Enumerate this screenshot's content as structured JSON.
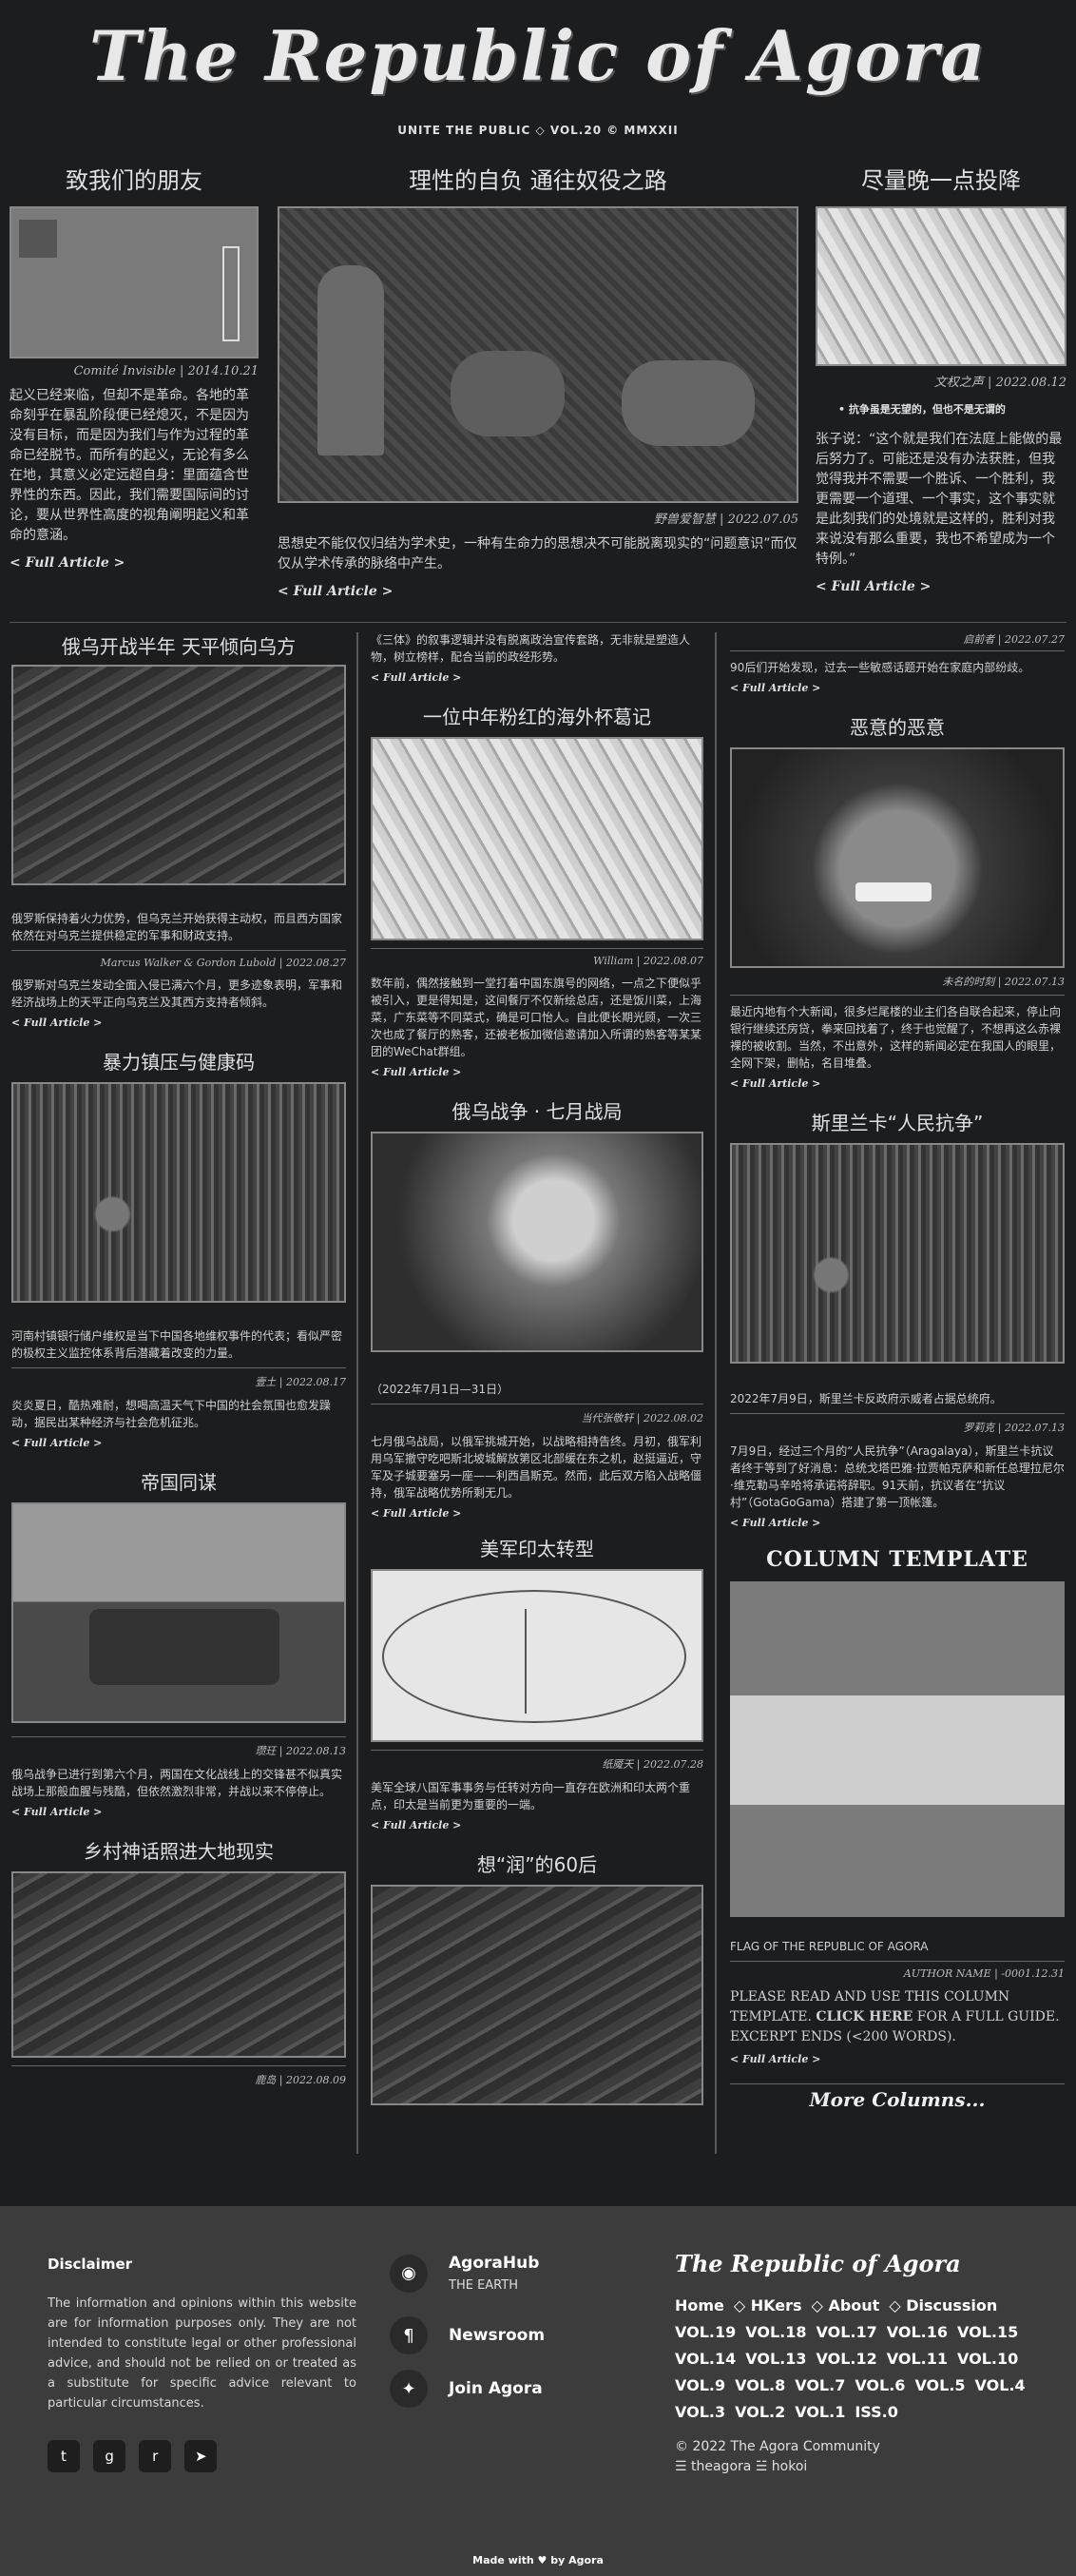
{
  "masthead": {
    "title": "The Republic of Agora",
    "subtitle": "UNITE THE PUBLIC ◇ VOL.20 © MMXXII"
  },
  "featured": [
    {
      "title": "致我们的朋友",
      "byline": "Comité Invisible | 2014.10.21",
      "body": "起义已经来临，但却不是革命。各地的革命刻乎在暴乱阶段便已经熄灭，不是因为没有目标，而是因为我们与作为过程的革命已经脱节。而所有的起义，无论有多么在地，其意义必定远超自身：里面蕴含世界性的东西。因此，我们需要国际间的讨论，要从世界性高度的视角阐明起义和革命的意涵。",
      "more": "< Full Article >"
    },
    {
      "title": "理性的自负 通往奴役之路",
      "byline": "野兽爱智慧 | 2022.07.05",
      "body": "思想史不能仅仅归结为学术史，一种有生命力的思想决不可能脱离现实的“问题意识”而仅仅从学术传承的脉络中产生。",
      "more": "< Full Article >"
    },
    {
      "title": "尽量晚一点投降",
      "byline": "文权之声 | 2022.08.12",
      "bullet": "抗争虽是无望的，但也不是无谓的",
      "body": "张子说：“这个就是我们在法庭上能做的最后努力了。可能还是没有办法获胜，但我觉得我并不需要一个胜诉、一个胜利，我更需要一个道理、一个事实，这个事实就是此刻我们的处境就是这样的，胜利对我来说没有那么重要，我也不希望成为一个特例。”",
      "more": "< Full Article >"
    }
  ],
  "col1": [
    {
      "title": "俄乌开战半年 天平倾向乌方",
      "caption": "俄罗斯保持着火力优势，但乌克兰开始获得主动权，而且西方国家依然在对乌克兰提供稳定的军事和财政支持。",
      "byline": "Marcus Walker & Gordon Lubold | 2022.08.27",
      "body": "俄罗斯对乌克兰发动全面入侵已满六个月，更多迹象表明，军事和经济战场上的天平正向乌克兰及其西方支持者倾斜。",
      "more": "< Full Article >"
    },
    {
      "title": "暴力镇压与健康码",
      "caption": "河南村镇银行储户维权是当下中国各地维权事件的代表；看似严密的极权主义监控体系背后潜藏着改变的力量。",
      "byline": "壹土 | 2022.08.17",
      "body": "炎炎夏日，酷热难耐，想喝高温天气下中国的社会氛围也愈发躁动，据民出某种经济与社会危机征兆。",
      "more": "< Full Article >"
    },
    {
      "title": "帝国同谋",
      "byline": "瓒玨 | 2022.08.13",
      "body": "俄乌战争已进行到第六个月，两国在文化战线上的交锋甚不似真实战场上那般血腥与残酷，但依然激烈非常，并战以来不停停止。",
      "more": "< Full Article >"
    },
    {
      "title": "乡村神话照进大地现实",
      "byline": "鹿岛 | 2022.08.09"
    }
  ],
  "col2": [
    {
      "body": "《三体》的叙事逻辑并没有脱离政治宣传套路，无非就是塑造人物，树立榜样，配合当前的政经形势。",
      "more": "< Full Article >"
    },
    {
      "title": "一位中年粉红的海外杯葛记",
      "byline": "William | 2022.08.07",
      "body": "数年前，偶然接触到一堂打着中国东旗号的网络，一点之下便似乎被引入，更是得知是，这间餐厅不仅新绘总店，还是饭川菜，上海菜，广东菜等不同菜式，确是可口怡人。自此便长期光顾，一次三次也成了餐厅的熟客，还被老板加微信邀请加入所谓的熟客等某某团的WeChat群组。",
      "more": "< Full Article >"
    },
    {
      "title": "俄乌战争 · 七月战局",
      "caption": "（2022年7月1日—31日）",
      "byline": "当代张敬轩 | 2022.08.02",
      "body": "七月俄乌战局，以俄军挑城开始，以战略相持告终。月初，俄军利用乌军撤守吃吧斯北坡城解放第区北部缓在东之机，赵挺逼近，守军及子城要塞另一座——利西昌斯克。然而，此后双方陷入战略僵持，俄军战略优势所剩无几。",
      "more": "< Full Article >"
    },
    {
      "title": "美军印太转型",
      "byline": "纸魇天 | 2022.07.28",
      "body": "美军全球八国军事事务与任转对方向一直存在欧洲和印太两个重点，印太是当前更为重要的一端。",
      "more": "< Full Article >"
    },
    {
      "title": "想“润”的60后"
    }
  ],
  "col3": [
    {
      "byline": "启前者 | 2022.07.27",
      "body": "90后们开始发现，过去一些敏感话题开始在家庭内部纷歧。",
      "more": "< Full Article >"
    },
    {
      "title": "恶意的恶意",
      "byline": "未名的时刻 | 2022.07.13",
      "body": "最近内地有个大新闻，很多烂尾楼的业主们各自联合起来，停止向银行继续还房贷，拳来回找着了，终于也觉醒了，不想再这么赤裸裸的被收割。当然，不出意外，这样的新闻必定在我国人的眼里，全网下架，删帖，名目堆叠。",
      "more": "< Full Article >"
    },
    {
      "title": "斯里兰卡“人民抗争”",
      "caption": "2022年7月9日，斯里兰卡反政府示威者占据总统府。",
      "byline": "罗莉克 | 2022.07.13",
      "body": "7月9日，经过三个月的“人民抗争”（Aragalaya），斯里兰卡抗议者终于等到了好消息：总统戈塔巴雅·拉贾帕克萨和新任总理拉尼尔·维克勒马辛哈将承诺将辞职。91天前，抗议者在“抗议村”（GotaGoGama）搭建了第一顶帐篷。",
      "more": "< Full Article >"
    },
    {
      "title": "COLUMN TEMPLATE",
      "caption": "FLAG OF THE REPUBLIC OF AGORA",
      "byline": "AUTHOR NAME | -0001.12.31",
      "body_pre": "PLEASE READ AND USE THIS COLUMN TEMPLATE. ",
      "body_link": "CLICK HERE",
      "body_post": " FOR A FULL GUIDE. EXCERPT ENDS (<200 WORDS).",
      "more": "< Full Article >"
    },
    {
      "title": "More Columns..."
    }
  ],
  "footer": {
    "disclaimer_title": "Disclaimer",
    "disclaimer_text": "The information and opinions within this website are for information purposes only. They are not intended to constitute legal or other professional advice, and should not be relied on or treated as a substitute for specific advice relevant to particular circumstances.",
    "social": [
      "twitter-icon",
      "github-icon",
      "reddit-icon",
      "telegram-icon"
    ],
    "links": [
      {
        "label": "AgoraHub",
        "sub": "THE EARTH",
        "icon": "◉"
      },
      {
        "label": "Newsroom",
        "sub": "",
        "icon": "¶"
      },
      {
        "label": "Join Agora",
        "sub": "",
        "icon": "✦"
      }
    ],
    "brand": "The Republic of Agora",
    "nav": [
      "Home",
      "HKers",
      "About",
      "Discussion"
    ],
    "vols": [
      [
        "VOL.19",
        "VOL.18",
        "VOL.17",
        "VOL.16",
        "VOL.15"
      ],
      [
        "VOL.14",
        "VOL.13",
        "VOL.12",
        "VOL.11",
        "VOL.10"
      ],
      [
        "VOL.9",
        "VOL.8",
        "VOL.7",
        "VOL.6",
        "VOL.5",
        "VOL.4"
      ],
      [
        "VOL.3",
        "VOL.2",
        "VOL.1",
        "ISS.0"
      ]
    ],
    "copyright": "© 2022 The Agora Community",
    "handles": "☰ theagora ☱ hokoi",
    "madewith": "Made with ♥ by Agora"
  }
}
